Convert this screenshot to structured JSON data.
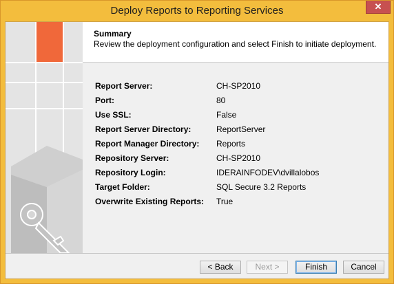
{
  "window": {
    "title": "Deploy Reports to Reporting Services",
    "close_glyph": "✕"
  },
  "header": {
    "title": "Summary",
    "description": "Review the deployment configuration and select Finish to initiate deployment."
  },
  "summary": [
    {
      "label": "Report Server:",
      "value": "CH-SP2010"
    },
    {
      "label": "Port:",
      "value": "80"
    },
    {
      "label": "Use SSL:",
      "value": "False"
    },
    {
      "label": "Report Server Directory:",
      "value": "ReportServer"
    },
    {
      "label": "Report Manager Directory:",
      "value": "Reports"
    },
    {
      "label": "Repository Server:",
      "value": "CH-SP2010"
    },
    {
      "label": "Repository Login:",
      "value": "IDERAINFODEV\\dvillalobos"
    },
    {
      "label": "Target Folder:",
      "value": "SQL Secure 3.2 Reports"
    },
    {
      "label": "Overwrite Existing Reports:",
      "value": "True"
    }
  ],
  "buttons": {
    "back": "< Back",
    "next": "Next >",
    "finish": "Finish",
    "cancel": "Cancel"
  },
  "side_panel_icon": "key-box-icon",
  "colors": {
    "title_bar": "#f3bd3d",
    "accent_orange": "#f0683a",
    "close_button": "#c75050"
  }
}
